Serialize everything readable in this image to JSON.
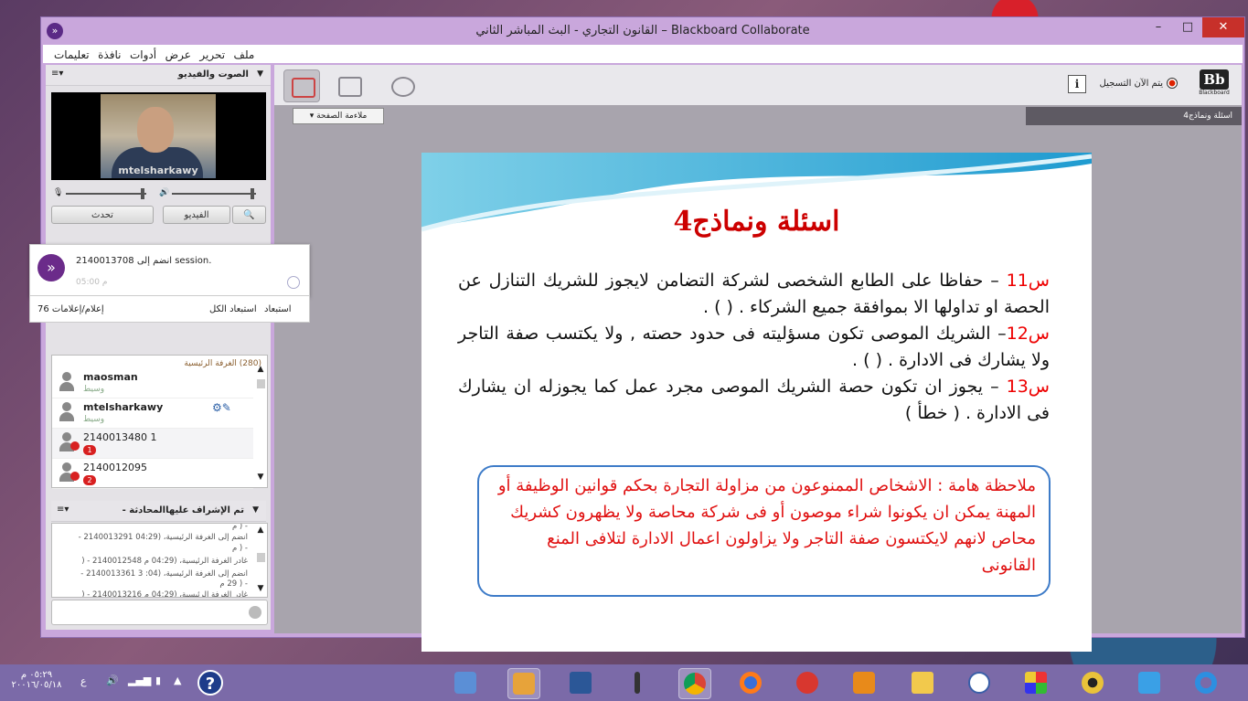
{
  "window": {
    "title": "القانون التجاري - البث المباشر الثاني – Blackboard Collaborate",
    "minimize": "–",
    "maximize": "□",
    "close": "✕"
  },
  "menu": [
    "ملف",
    "تحرير",
    "عرض",
    "أدوات",
    "نافذة",
    "تعليمات"
  ],
  "audio_video": {
    "title": "الصوت والفيديو",
    "video_caption": "mtelsharkawy",
    "talk_button": "تحدث",
    "video_button": "الفيديو"
  },
  "notification": {
    "text": "2140013708 انضم إلى session.",
    "time": "05:00 م"
  },
  "alerts": {
    "count_label": "76 إعلام/إعلامات",
    "restore_all": "استبعاد الكل",
    "restore": "استبعاد"
  },
  "participants": {
    "room_label": "(280) الغرفة الرئيسية",
    "items": [
      {
        "name": "maosman",
        "role": "وسيط"
      },
      {
        "name": "mtelsharkawy",
        "role": "وسيط"
      },
      {
        "name": "2140013480 1",
        "badge": "1"
      },
      {
        "name": "2140012095",
        "badge": "2"
      }
    ]
  },
  "chat": {
    "title": "تم الإشراف عليهاالمحادثة -",
    "lines": [
      "- ( م",
      "انضم إلى الغرفة الرئيسية، (04:29 2140013291 -",
      "- ( م",
      "غادر الغرفة الرئيسية، (04:29 م 2140012548 - (",
      "انضم إلى الغرفة الرئيسية، (04: 3 2140013361 -",
      "- ( 29 م",
      "غادر الغرفة الرئيسية، (04:29 م 2140013216 - ("
    ]
  },
  "toolbar": {
    "recording": "يتم الآن التسجيل",
    "info": "i",
    "logo": "Bb",
    "logo_sub": "Blackboard"
  },
  "content": {
    "fit_page": "ملاءمة الصفحة",
    "page_tab": "اسئلة ونماذج4"
  },
  "slide": {
    "title": "اسئلة ونماذج4",
    "q11_num": "س11",
    "q11_text": " – حفاظا على الطابع الشخصى لشركة التضامن لايجوز للشريك التنازل عن الحصة او تداولها الا بموافقة جميع الشركاء .            (      ) .",
    "q12_num": "س12",
    "q12_text": "– الشريك الموصى تكون مسؤليته فى حدود حصته , ولا يكتسب صفة التاجر ولا يشارك فى الادارة .          (      ) .",
    "q13_num": "س13",
    "q13_text": " – يجوز ان تكون حصة الشريك الموصى مجرد عمل كما يجوزله ان يشارك فى الادارة .               ( خطأ )",
    "note": "ملاحظة هامة : الاشخاص الممنوعون من مزاولة التجارة بحكم قوانين الوظيفة أو المهنة  يمكن ان يكونوا شراء موصون أو فى شركة محاصة ولا يظهرون كشريك محاص  لانهم لايكتسون صفة التاجر ولا يزاولون اعمال الادارة  لتلافى المنع القانونى"
  },
  "taskbar": {
    "time": "٠٥:٢٩ م",
    "date": "٢٠٠١٦/٠٥/١٨",
    "lang": "ع",
    "help": "?"
  },
  "colors": {
    "window_frame": "#c9a7dc",
    "accent_red": "#e01010",
    "note_border": "#3d7bc8",
    "taskbar": "#7b6aa8"
  }
}
